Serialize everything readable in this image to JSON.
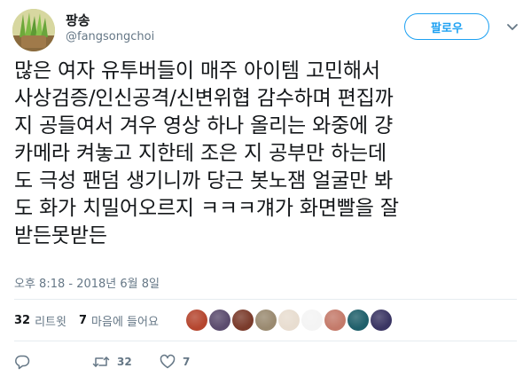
{
  "author": {
    "display_name": "팡송",
    "handle": "@fangsongchoi"
  },
  "follow_button": {
    "label": "팔로우"
  },
  "tweet": {
    "lines": [
      "많은 여자 유투버들이 매주 아이템 고민해서",
      "사상검증/인신공격/신변위협 감수하며 편집까",
      "지 공들여서 겨우 영상 하나 올리는 와중에 걍",
      "카메라 켜놓고 지한테 조은 지 공부만 하는데",
      "도 극성 팬덤 생기니까 당근 봇노잼 얼굴만 봐",
      "도 화가 치밀어오르지 ㅋㅋㅋ걔가 화면빨을 잘",
      "받든못받든"
    ],
    "timestamp": "오후 8:18 - 2018년 6월 8일"
  },
  "stats": {
    "retweets_count": "32",
    "retweets_label": "리트윗",
    "likes_count": "7",
    "likes_label": "마음에 들어요"
  },
  "likers": [
    {
      "name": "liker-avatar-1",
      "color": "#b5462f"
    },
    {
      "name": "liker-avatar-2",
      "color": "#5b4c6e"
    },
    {
      "name": "liker-avatar-3",
      "color": "#7a3b2b"
    },
    {
      "name": "liker-avatar-4",
      "color": "#9a8a70"
    },
    {
      "name": "liker-avatar-5",
      "color": "#e8ddd0"
    },
    {
      "name": "liker-avatar-6",
      "color": "#f4f4f4"
    },
    {
      "name": "liker-avatar-7",
      "color": "#c47a6a"
    },
    {
      "name": "liker-avatar-8",
      "color": "#1f5f6a"
    },
    {
      "name": "liker-avatar-9",
      "color": "#3a3563"
    }
  ],
  "actions": {
    "reply_count": "",
    "retweet_count": "32",
    "like_count": "7"
  },
  "colors": {
    "accent": "#1da1f2",
    "text": "#14171a",
    "secondary": "#657786",
    "divider": "#e6ecf0"
  }
}
